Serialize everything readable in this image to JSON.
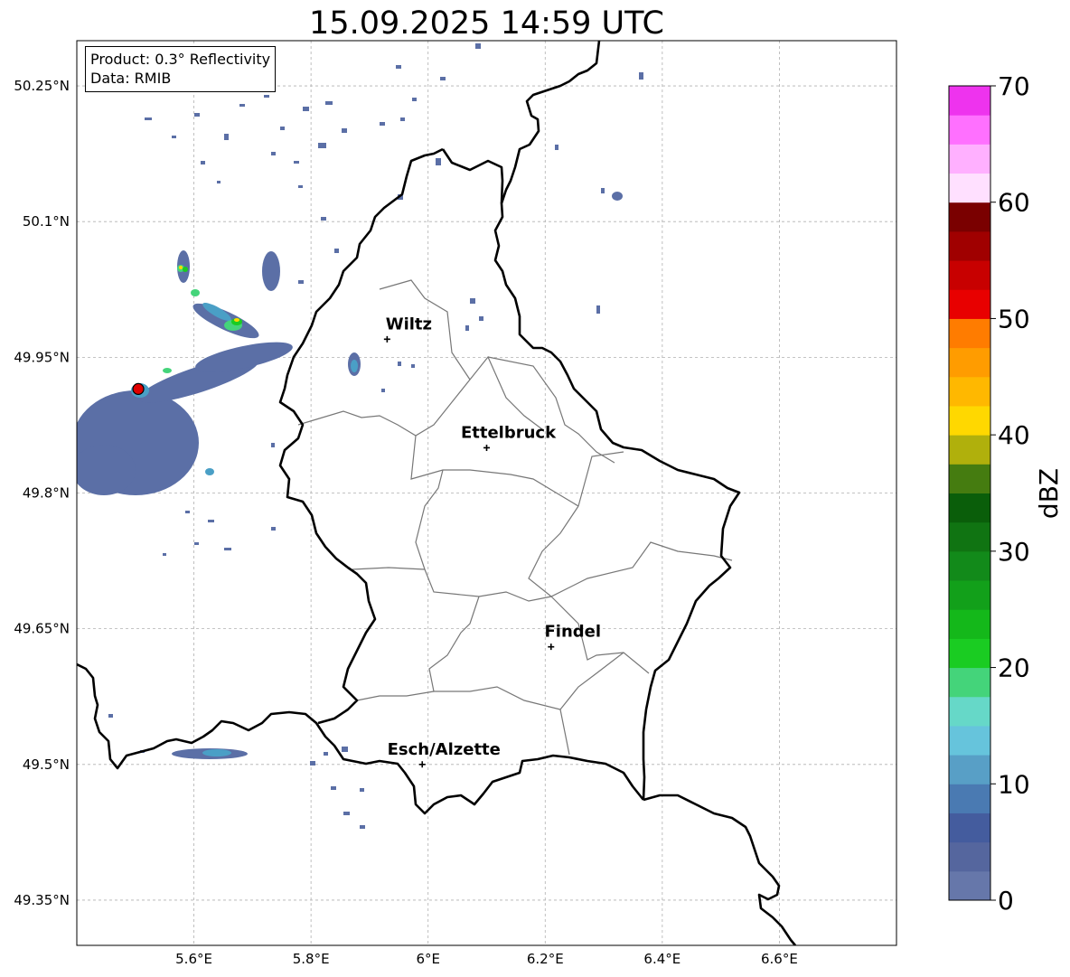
{
  "title": "15.09.2025 14:59 UTC",
  "info": {
    "product": "Product: 0.3° Reflectivity",
    "data": "Data: RMIB"
  },
  "map": {
    "lon_range": [
      5.4,
      6.8
    ],
    "lat_range": [
      49.3,
      50.3
    ],
    "lat_ticks": [
      {
        "value": 50.25,
        "label": "50.25°N"
      },
      {
        "value": 50.1,
        "label": "50.1°N"
      },
      {
        "value": 49.95,
        "label": "49.95°N"
      },
      {
        "value": 49.8,
        "label": "49.8°N"
      },
      {
        "value": 49.65,
        "label": "49.65°N"
      },
      {
        "value": 49.5,
        "label": "49.5°N"
      },
      {
        "value": 49.35,
        "label": "49.35°N"
      }
    ],
    "lon_ticks": [
      {
        "value": 5.6,
        "label": "5.6°E"
      },
      {
        "value": 5.8,
        "label": "5.8°E"
      },
      {
        "value": 6.0,
        "label": "6°E"
      },
      {
        "value": 6.2,
        "label": "6.2°E"
      },
      {
        "value": 6.4,
        "label": "6.4°E"
      },
      {
        "value": 6.6,
        "label": "6.6°E"
      }
    ],
    "cities": [
      {
        "name": "Wiltz",
        "lon": 5.93,
        "lat": 49.97
      },
      {
        "name": "Ettelbruck",
        "lon": 6.1,
        "lat": 49.85
      },
      {
        "name": "Findel",
        "lon": 6.21,
        "lat": 49.63
      },
      {
        "name": "Esch/Alzette",
        "lon": 5.99,
        "lat": 49.5
      }
    ],
    "radar_site": {
      "lon": 5.505,
      "lat": 49.915,
      "color": "#e00000"
    }
  },
  "colorbar": {
    "label": "dBZ",
    "min": 0,
    "max": 70,
    "ticks": [
      {
        "value": 0,
        "label": "0"
      },
      {
        "value": 10,
        "label": "10"
      },
      {
        "value": 20,
        "label": "20"
      },
      {
        "value": 30,
        "label": "30"
      },
      {
        "value": 40,
        "label": "40"
      },
      {
        "value": 50,
        "label": "50"
      },
      {
        "value": 60,
        "label": "60"
      },
      {
        "value": 70,
        "label": "70"
      }
    ],
    "colors": [
      "#6677aa",
      "#55669e",
      "#445c9e",
      "#4a7ab2",
      "#589fc6",
      "#66c4dc",
      "#66d8c8",
      "#44d47a",
      "#1acc22",
      "#14b81a",
      "#12a01a",
      "#128a1a",
      "#107412",
      "#0a5e0a",
      "#457c10",
      "#b0b00c",
      "#ffd800",
      "#ffb800",
      "#ff9c00",
      "#ff7c00",
      "#e80000",
      "#c80000",
      "#a00000",
      "#7a0000",
      "#ffe0ff",
      "#ffb0ff",
      "#ff70ff",
      "#ee33ee"
    ]
  }
}
